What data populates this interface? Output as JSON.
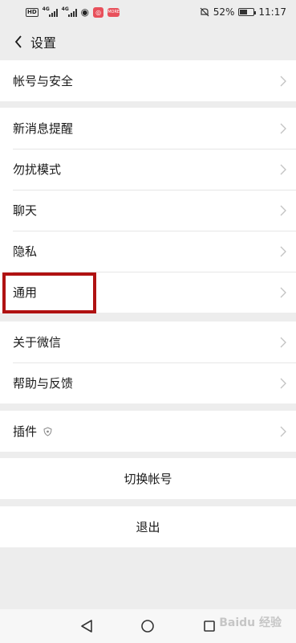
{
  "status_bar": {
    "hd": "HD",
    "network_1": "4G",
    "network_2": "4G",
    "app_badge_2": "MORE",
    "battery_percent": "52%",
    "battery_level": 0.52,
    "time": "11:17",
    "icons": [
      "hd-icon",
      "signal-icon",
      "eye-icon",
      "app-icon",
      "mute-icon",
      "battery-icon"
    ]
  },
  "header": {
    "title": "设置"
  },
  "sections": {
    "account": [
      {
        "label": "帐号与安全"
      }
    ],
    "settings": [
      {
        "label": "新消息提醒"
      },
      {
        "label": "勿扰模式"
      },
      {
        "label": "聊天"
      },
      {
        "label": "隐私"
      },
      {
        "label": "通用"
      }
    ],
    "about": [
      {
        "label": "关于微信"
      },
      {
        "label": "帮助与反馈"
      }
    ],
    "plugins": [
      {
        "label": "插件"
      }
    ]
  },
  "actions": {
    "switch_account": "切换帐号",
    "logout": "退出"
  },
  "watermark": "Baidu 经验",
  "colors": {
    "background": "#ededed",
    "cell": "#ffffff",
    "highlight_border": "#b01212",
    "chevron": "#c2c2c2"
  }
}
